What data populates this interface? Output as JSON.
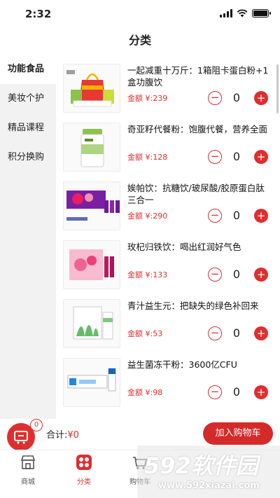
{
  "status_bar": {
    "time": "2:32"
  },
  "nav": {
    "title": "分类"
  },
  "sidebar": {
    "items": [
      {
        "label": "功能食品",
        "active": true
      },
      {
        "label": "美妆个护",
        "active": false
      },
      {
        "label": "精品课程",
        "active": false
      },
      {
        "label": "积分换购",
        "active": false
      }
    ]
  },
  "products": [
    {
      "name": "一起减重十万斤：1箱阻卡蛋白粉+1盒功腹饮",
      "price": "金额 ¥:239",
      "qty": "0",
      "thumb_icon": "gift-bag-product-image"
    },
    {
      "name": "奇亚籽代餐粉：饱腹代餐，营养全面",
      "price": "金额 ¥:128",
      "qty": "0",
      "thumb_icon": "green-jar-product-image"
    },
    {
      "name": "娭帕饮：抗糖饮/玻尿酸/胶原蛋白肽三合一",
      "price": "金额 ¥:290",
      "qty": "0",
      "thumb_icon": "purple-box-product-image"
    },
    {
      "name": "玫杞归铁饮：喝出红润好气色",
      "price": "金额 ¥:133",
      "qty": "0",
      "thumb_icon": "pink-box-product-image"
    },
    {
      "name": "青汁益生元：把缺失的绿色补回来",
      "price": "金额 ¥:53",
      "qty": "0",
      "thumb_icon": "green-box-product-image"
    },
    {
      "name": "益生菌冻干粉：3600亿CFU",
      "price": "金额 ¥:98",
      "qty": "0",
      "thumb_icon": "blue-box-product-image"
    }
  ],
  "stepper": {
    "minus": "−",
    "plus": "+"
  },
  "cart": {
    "badge": "0",
    "total_label": "合计:",
    "total_value": "¥0",
    "checkout_label": "加入购物车"
  },
  "tabbar": {
    "items": [
      {
        "label": "商城",
        "icon": "store-icon",
        "active": false
      },
      {
        "label": "分类",
        "icon": "category-icon",
        "active": true
      },
      {
        "label": "购物车",
        "icon": "cart-icon",
        "active": false
      }
    ]
  },
  "watermark": {
    "big": "592软件园",
    "small": "www.592xiazai.com"
  },
  "colors": {
    "accent": "#e02e2e",
    "sidebar_bg": "#f2f2f2"
  }
}
